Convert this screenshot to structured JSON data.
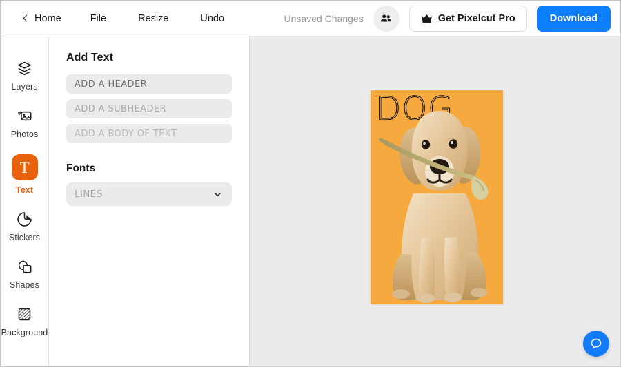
{
  "header": {
    "home_label": "Home",
    "menu": [
      {
        "label": "File",
        "name": "menu-file"
      },
      {
        "label": "Resize",
        "name": "menu-resize"
      },
      {
        "label": "Undo",
        "name": "menu-undo"
      }
    ],
    "status_text": "Unsaved Changes",
    "collaborate_icon": "people-icon",
    "pro_button": {
      "label": "Get Pixelcut Pro",
      "icon": "crown-icon"
    },
    "download_button": {
      "label": "Download",
      "color": "#0d7efc"
    }
  },
  "sidebar": {
    "items": [
      {
        "label": "Layers",
        "icon": "layers-icon",
        "active": false
      },
      {
        "label": "Photos",
        "icon": "photos-icon",
        "active": false
      },
      {
        "label": "Text",
        "icon": "text-t-icon",
        "active": true
      },
      {
        "label": "Stickers",
        "icon": "stickers-icon",
        "active": false
      },
      {
        "label": "Shapes",
        "icon": "shapes-icon",
        "active": false
      },
      {
        "label": "Background",
        "icon": "background-icon",
        "active": false
      }
    ],
    "active_color": "#e8610d"
  },
  "panel": {
    "title": "Add Text",
    "fields": [
      {
        "placeholder": "ADD A HEADER",
        "value": "",
        "name": "header-text-input"
      },
      {
        "placeholder": "ADD A SUBHEADER",
        "value": "",
        "name": "subheader-text-input"
      },
      {
        "placeholder": "ADD A BODY OF TEXT",
        "value": "",
        "name": "body-text-input"
      }
    ],
    "fonts_section_title": "Fonts",
    "font_select": {
      "value": "LINES",
      "icon": "chevron-down-icon"
    }
  },
  "canvas": {
    "background_color": "#ebebeb",
    "artboard": {
      "background_color": "#f5a93e",
      "overlay_text": "DOG",
      "image_subject": "golden-retriever-holding-flower"
    }
  },
  "help": {
    "icon": "chat-bubble-icon",
    "color": "#117bfb"
  }
}
